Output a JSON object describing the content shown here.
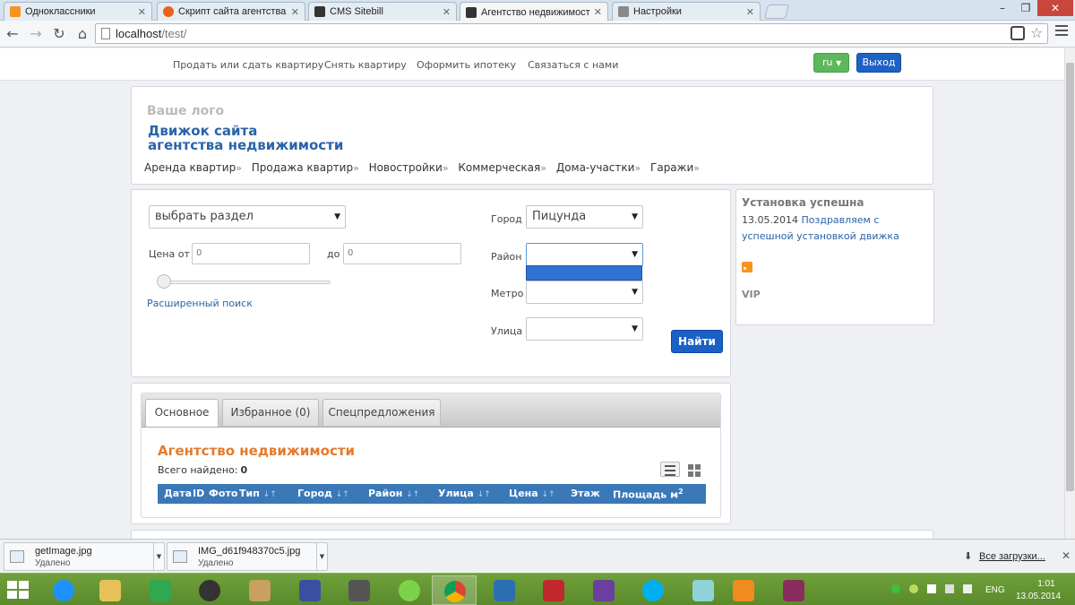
{
  "browser": {
    "tabs": [
      {
        "title": "Одноклассники",
        "icon": "odnoklassniki-icon",
        "color": "#f7931e"
      },
      {
        "title": "Скрипт сайта агентства н",
        "icon": "sitebill-s-icon",
        "color": "#e8621c"
      },
      {
        "title": "CMS Sitebill",
        "icon": "incognito-icon",
        "color": "#333333"
      },
      {
        "title": "Агентство недвижимост",
        "icon": "incognito-icon",
        "color": "#333333"
      },
      {
        "title": "Настройки",
        "icon": "wrench-icon",
        "color": "#666666"
      }
    ],
    "url_host": "localhost",
    "url_path": "/test/"
  },
  "topnav": {
    "links": [
      "Продать или сдать квартиру",
      "Снять квартиру",
      "Оформить ипотеку",
      "Связаться с нами"
    ],
    "lang_label": "ru",
    "logout_label": "Выход"
  },
  "header": {
    "logo_placeholder": "Ваше лого",
    "site_title_line1": "Движок сайта",
    "site_title_line2": "агентства недвижимости",
    "menu": [
      "Аренда квартир",
      "Продажа квартир",
      "Новостройки",
      "Коммерческая",
      "Дома-участки",
      "Гаражи"
    ],
    "menu_suffix": "»"
  },
  "search": {
    "section_select": "выбрать раздел",
    "price_from_label": "Цена от",
    "price_from_value": "0",
    "price_to_label": "до",
    "price_to_value": "0",
    "advanced_search": "Расширенный поиск",
    "city_label": "Город",
    "city_value": "Пицунда",
    "district_label": "Район",
    "district_value": "",
    "metro_label": "Метро",
    "metro_value": "",
    "street_label": "Улица",
    "street_value": "",
    "find_button": "Найти"
  },
  "news": {
    "title": "Установка успешна",
    "date": "13.05.2014",
    "text": "Поздравляем с успешной установкой движка",
    "vip_label": "VIP"
  },
  "results": {
    "tabs": [
      "Основное",
      "Избранное (0)",
      "Спецпредложения"
    ],
    "heading": "Агентство недвижимости",
    "found_label": "Всего найдено:",
    "found_count": "0",
    "columns": [
      "Дата",
      "ID",
      "Фото",
      "Тип",
      "Город",
      "Район",
      "Улица",
      "Цена",
      "Этаж",
      "Площадь м"
    ],
    "sort_glyph": "↓↑",
    "area_unit_sup": "2"
  },
  "downloads": {
    "items": [
      {
        "name": "getImage.jpg",
        "status": "Удалено"
      },
      {
        "name": "IMG_d61f948370c5.jpg",
        "status": "Удалено"
      }
    ],
    "all_downloads": "Все загрузки..."
  },
  "taskbar": {
    "apps": [
      "internet-explorer-icon",
      "file-explorer-icon",
      "store-icon",
      "speaker-app-icon",
      "media-app-icon",
      "floppy-save-icon",
      "game-app-icon",
      "icq-icon",
      "chrome-icon",
      "control-panel-icon",
      "power-app-icon",
      "visual-studio-icon",
      "skype-icon",
      "notes-app-icon",
      "video-player-icon",
      "winrar-icon"
    ],
    "language": "ENG",
    "time": "1:01",
    "date": "13.05.2014"
  },
  "colors": {
    "brand_blue": "#2a63a8",
    "heading_orange": "#e57a2c",
    "table_header": "#3a78b8",
    "lang_green": "#5cb85c",
    "button_blue": "#1a60c5",
    "taskbar_green": "#6fa13a"
  }
}
